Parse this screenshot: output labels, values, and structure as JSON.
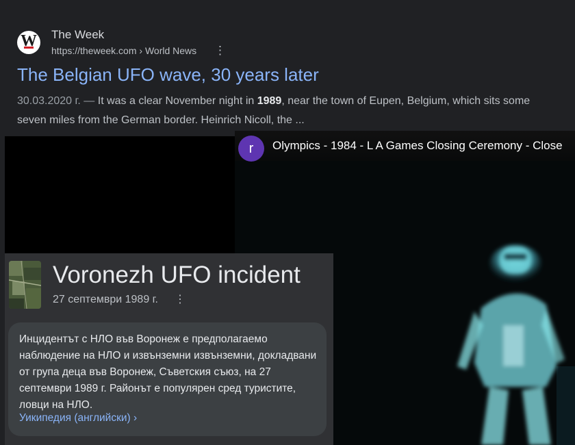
{
  "search_result": {
    "site_name": "The Week",
    "url": "https://theweek.com › World News",
    "title": "The Belgian UFO wave, 30 years later",
    "date": "30.03.2020 г. —",
    "snippet_before": " It was a clear November night in ",
    "snippet_bold": "1989",
    "snippet_after": ", near the town of Eupen, Belgium, which sits some seven miles from the German border. Heinrich Nicoll, the ...",
    "favicon_letter": "W",
    "more_icon": "⋮"
  },
  "video": {
    "channel_initial": "r",
    "title": "Olympics - 1984 - L A Games Closing Ceremony - Close"
  },
  "knowledge_card": {
    "title": "Voronezh UFO incident",
    "subtitle": "27 септември 1989 г.",
    "more_icon": "⋮",
    "description": "Инцидентът с НЛО във Воронеж е предполагаемо наблюдение на НЛО и извънземни извънземни, докладвани от група деца във Воронеж, Съветския съюз, на 27 септември 1989 г. Районът е популярен сред туристите, ловци на НЛО.",
    "source_link": "Уикипедия (английски) ›"
  },
  "colors": {
    "background": "#202124",
    "link_blue": "#8ab4f8",
    "card_bg": "#303134",
    "desc_bg": "#3c4043",
    "avatar_purple": "#5e35b1",
    "figure_glow": "#7fe6ee"
  }
}
